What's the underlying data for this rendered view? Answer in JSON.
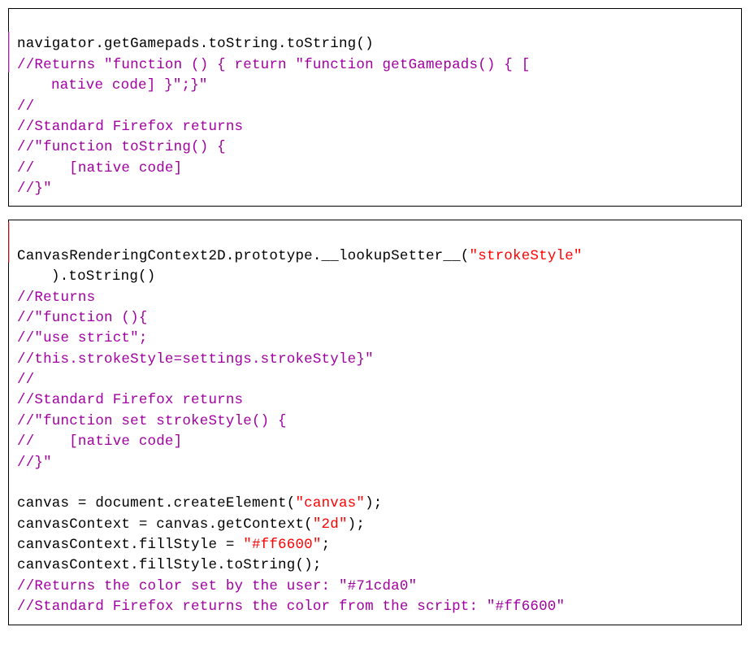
{
  "block1": {
    "l1": "navigator.getGamepads.toString.toString()",
    "l2a": "//Returns \"function () { return \"function getGamepads() { [",
    "l2b": "native code] }\";}\"",
    "l3": "//",
    "l4": "//Standard Firefox returns",
    "l5": "//\"function toString() {",
    "l6": "//    [native code]",
    "l7": "//}\""
  },
  "block2": {
    "l1a": "CanvasRenderingContext2D.prototype.__lookupSetter__(",
    "l1s": "\"strokeStyle\"",
    "l1b": ").toString()",
    "l2": "//Returns",
    "l3": "//\"function (){",
    "l4": "//\"use strict\";",
    "l5": "//this.strokeStyle=settings.strokeStyle}\"",
    "l6": "//",
    "l7": "//Standard Firefox returns",
    "l8": "//\"function set strokeStyle() {",
    "l9": "//    [native code]",
    "l10": "//}\"",
    "blank": "",
    "l12a": "canvas = document.createElement(",
    "l12s": "\"canvas\"",
    "l12b": ");",
    "l13a": "canvasContext = canvas.getContext(",
    "l13s": "\"2d\"",
    "l13b": ");",
    "l14a": "canvasContext.fillStyle = ",
    "l14s": "\"#ff6600\"",
    "l14b": ";",
    "l15": "canvasContext.fillStyle.toString();",
    "l16": "//Returns the color set by the user: \"#71cda0\"",
    "l17": "//Standard Firefox returns the color from the script: \"#ff6600\""
  }
}
